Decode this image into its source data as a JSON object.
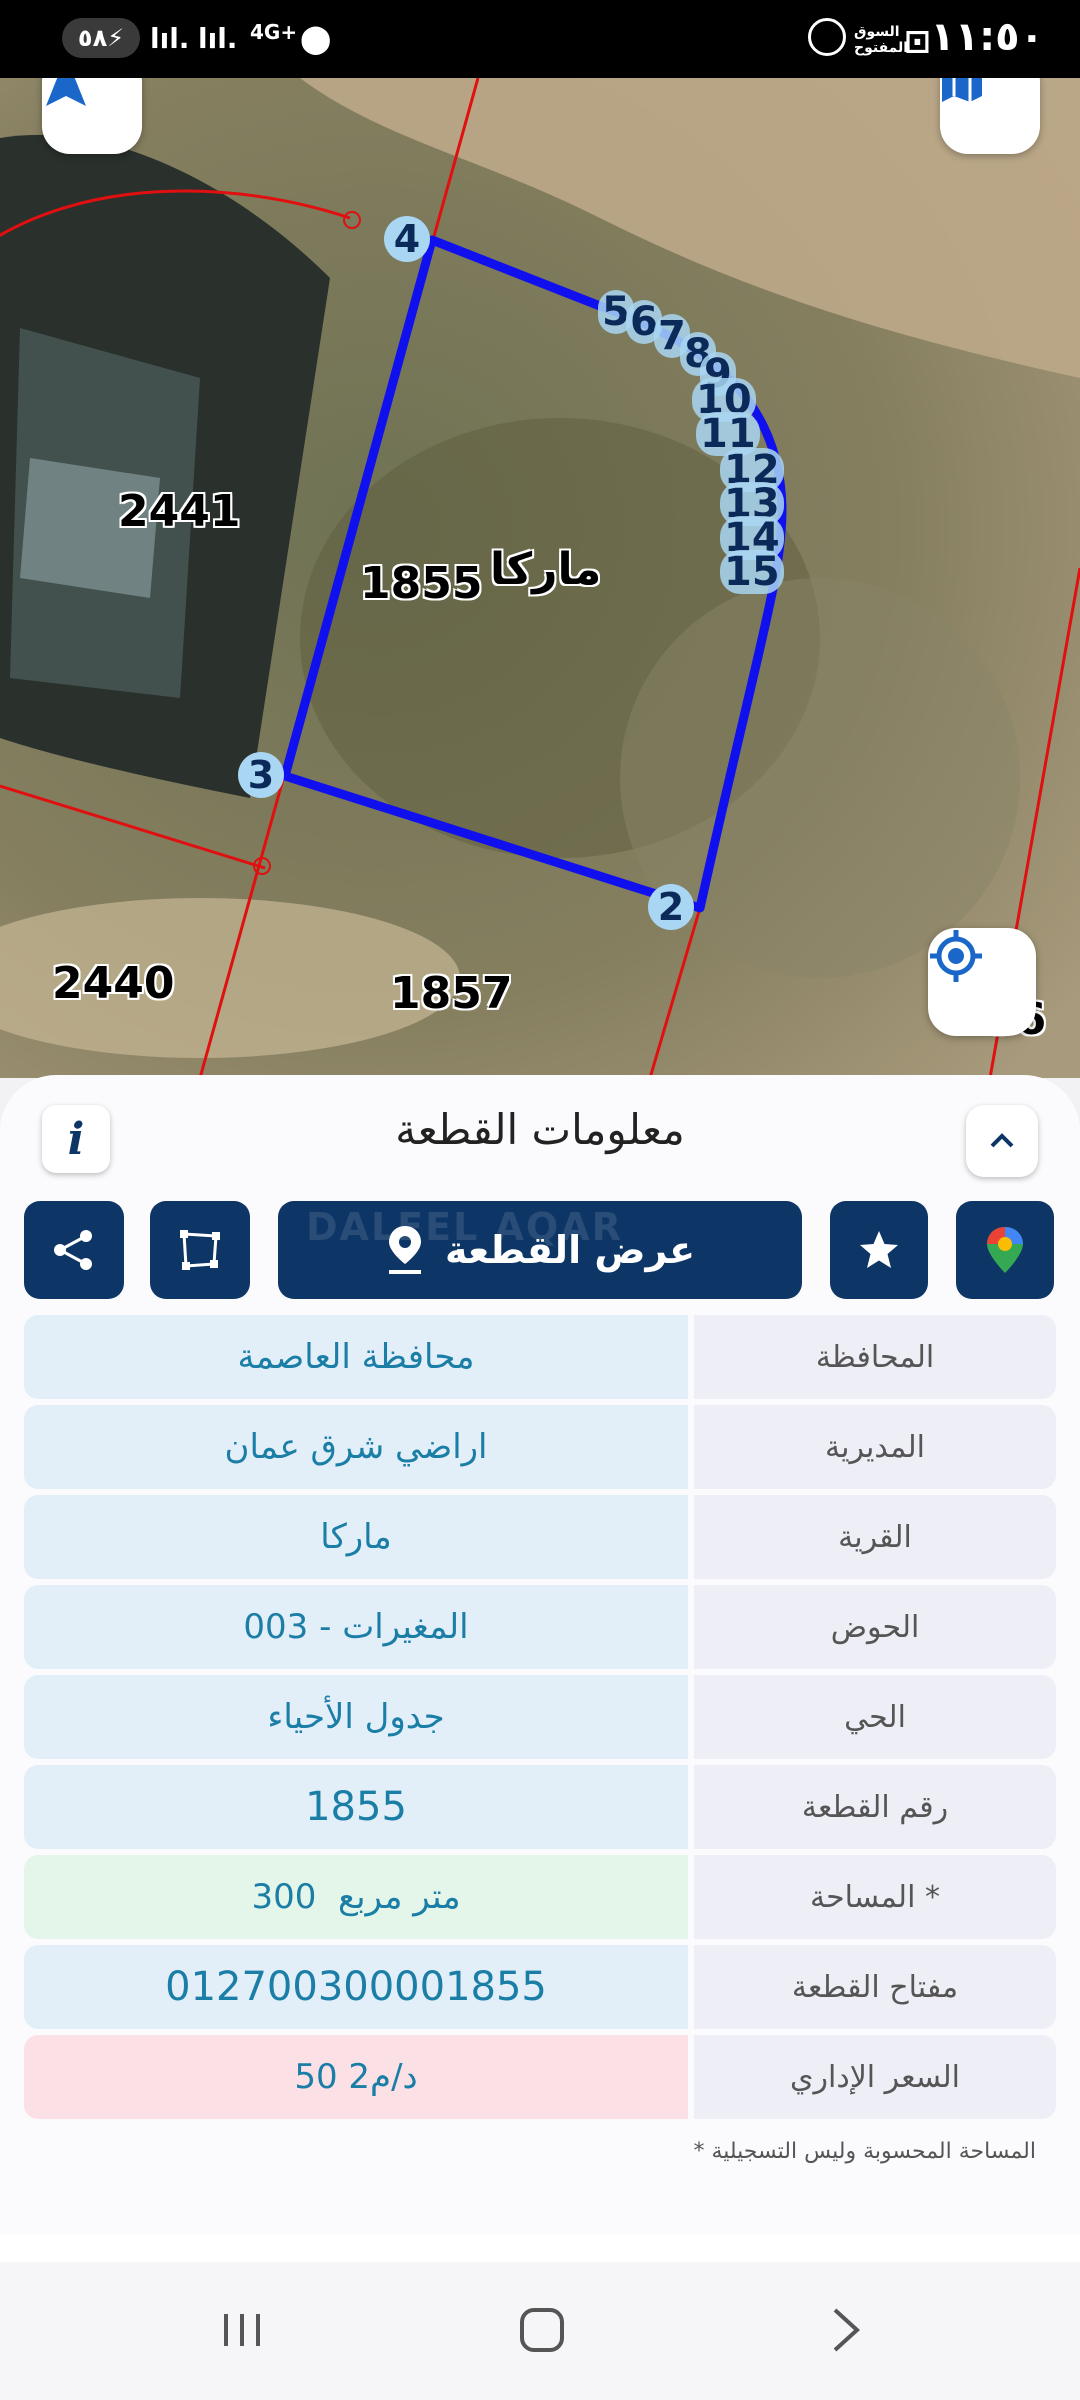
{
  "status": {
    "battery": "٥٨",
    "network": "4G+",
    "time": "١١:٥٠",
    "app_badge": "السوق المفتوح"
  },
  "map": {
    "labels": {
      "current_parcel": "1855",
      "village": "ماركا",
      "neighbor_1": "2441",
      "neighbor_2": "2440",
      "neighbor_3": "1857",
      "neighbor_4": "56"
    },
    "vertices": [
      "4",
      "3",
      "2"
    ],
    "arc_numbers": [
      "5",
      "6",
      "7",
      "8",
      "9",
      "10",
      "11",
      "12",
      "13",
      "14",
      "15"
    ],
    "colors": {
      "parcel_outline": "#1010ee",
      "neighbor_lines": "#e01010",
      "brand": "#0d3566"
    }
  },
  "sheet": {
    "title": "معلومات القطعة",
    "view_button": "عرض القطعة",
    "watermark": "DALEEL AQAR",
    "rows": [
      {
        "label": "المحافظة",
        "value": "محافظة العاصمة"
      },
      {
        "label": "المديرية",
        "value": "اراضي شرق عمان"
      },
      {
        "label": "القرية",
        "value": "ماركا"
      },
      {
        "label": "الحوض",
        "value": "المغيرات - 003"
      },
      {
        "label": "الحي",
        "value": "جدول الأحياء"
      },
      {
        "label": "رقم القطعة",
        "value": "1855"
      },
      {
        "label": "المساحة *",
        "value": "300  متر مربع"
      },
      {
        "label": "مفتاح القطعة",
        "value": "012700300001855"
      },
      {
        "label": "السعر الإداري",
        "value": "50 د/م2"
      }
    ],
    "footnote": "* المساحة المحسوبة وليس التسجيلية"
  }
}
